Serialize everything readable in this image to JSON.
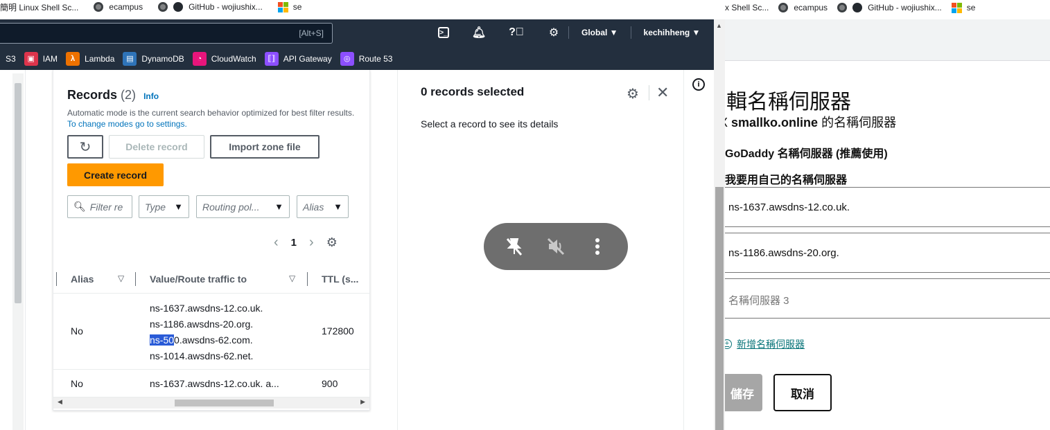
{
  "left_bookmarks": [
    {
      "label": "簡明 Linux Shell Sc..."
    },
    {
      "label": "ecampus",
      "icon": "globe-icon"
    },
    {
      "label": "GitHub - wojiushix...",
      "icon": "github-icon"
    },
    {
      "label": "se",
      "icon": "microsoft-icon"
    }
  ],
  "aws": {
    "search_shortcut": "[Alt+S]",
    "region": "Global ▼",
    "user": "kechihheng ▼",
    "services": [
      {
        "label": "S3",
        "color": "#3f8624"
      },
      {
        "label": "IAM",
        "color": "#dd344c"
      },
      {
        "label": "Lambda",
        "color": "#ed7100"
      },
      {
        "label": "DynamoDB",
        "color": "#2e73b8"
      },
      {
        "label": "CloudWatch",
        "color": "#e7157b"
      },
      {
        "label": "API Gateway",
        "color": "#8c4fff"
      },
      {
        "label": "Route 53",
        "color": "#8c4fff"
      }
    ]
  },
  "records": {
    "title": "Records",
    "count": "(2)",
    "info": "Info",
    "description": "Automatic mode is the current search behavior optimized for best filter results.",
    "change_link": "To change modes go to settings.",
    "delete_label": "Delete record",
    "import_label": "Import zone file",
    "create_label": "Create record",
    "filter_placeholder": "Filter re",
    "filter_type": "Type",
    "filter_routing": "Routing pol...",
    "filter_alias": "Alias",
    "page": "1",
    "columns": {
      "alias": "Alias",
      "value": "Value/Route traffic to",
      "ttl": "TTL (s..."
    },
    "rows": [
      {
        "alias": "No",
        "values_line1": "ns-1637.awsdns-12.co.uk.",
        "values_line2": "ns-1186.awsdns-20.org.",
        "values_line3_sel": "ns-50",
        "values_line3_rest": "0.awsdns-62.com.",
        "values_line4": "ns-1014.awsdns-62.net.",
        "ttl": "172800"
      },
      {
        "alias": "No",
        "value": "ns-1637.awsdns-12.co.uk. a...",
        "ttl": "900"
      }
    ]
  },
  "detail": {
    "title": "0 records selected",
    "subtitle": "Select a record to see its details"
  },
  "right_bookmarks": [
    {
      "label": "x Shell Sc..."
    },
    {
      "label": "ecampus",
      "icon": "globe-icon"
    },
    {
      "label": "GitHub - wojiushix...",
      "icon": "github-icon"
    },
    {
      "label": "se",
      "icon": "microsoft-icon"
    }
  ],
  "godaddy": {
    "title": "輯名稱伺服器",
    "subtitle_prefix": "X ",
    "subtitle_domain": "smallko.online",
    "subtitle_suffix": " 的名稱伺服器",
    "option1": "GoDaddy 名稱伺服器 (推薦使用)",
    "option2": "我要用自己的名稱伺服器",
    "ns1": "ns-1637.awsdns-12.co.uk.",
    "ns2": "ns-1186.awsdns-20.org.",
    "ns3_placeholder": "名稱伺服器 3",
    "add_link": "新增名稱伺服器",
    "save_label": "儲存",
    "cancel_label": "取消"
  }
}
